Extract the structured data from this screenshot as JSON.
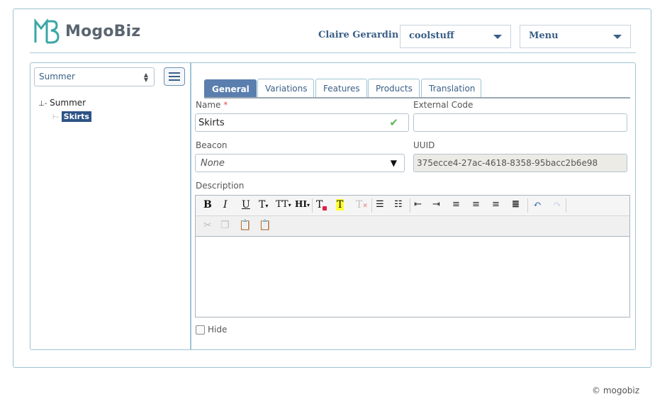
{
  "header": {
    "logo_text": "MogoBiz",
    "user_name": "Claire Gerardin",
    "store_select": "coolstuff",
    "menu_select": "Menu"
  },
  "sidebar": {
    "category_select": "Summer",
    "tree": {
      "root": "Summer",
      "child": "Skirts"
    }
  },
  "tabs": [
    {
      "label": "General",
      "active": true
    },
    {
      "label": "Variations"
    },
    {
      "label": "Features"
    },
    {
      "label": "Products"
    },
    {
      "label": "Translation"
    }
  ],
  "form": {
    "name_label": "Name",
    "required_mark": "*",
    "name_value": "Skirts",
    "external_code_label": "External Code",
    "external_code_value": "",
    "beacon_label": "Beacon",
    "beacon_value": "None",
    "uuid_label": "UUID",
    "uuid_value": "375ecce4-27ac-4618-8358-95bacc2b6e98",
    "description_label": "Description",
    "hide_label": "Hide",
    "hide_checked": false
  },
  "editor_toolbar": {
    "row1": [
      "bold-icon",
      "italic-icon",
      "underline-icon",
      "font-size-icon",
      "font-family-icon",
      "heading-icon",
      "text-color-icon",
      "highlight-icon",
      "clear-format-icon",
      "bullet-list-icon",
      "numbered-list-icon",
      "outdent-icon",
      "indent-icon",
      "align-left-icon",
      "align-center-icon",
      "align-right-icon",
      "justify-icon",
      "undo-icon",
      "redo-icon"
    ],
    "row2": [
      "cut-icon",
      "copy-icon",
      "paste-icon",
      "paste-text-icon"
    ]
  },
  "footer": {
    "copyright": "© mogobiz"
  },
  "colors": {
    "accent": "#3a5f86",
    "tab_active": "#5a7fae",
    "border": "#9fc3d4",
    "selected_node": "#2d5386"
  }
}
